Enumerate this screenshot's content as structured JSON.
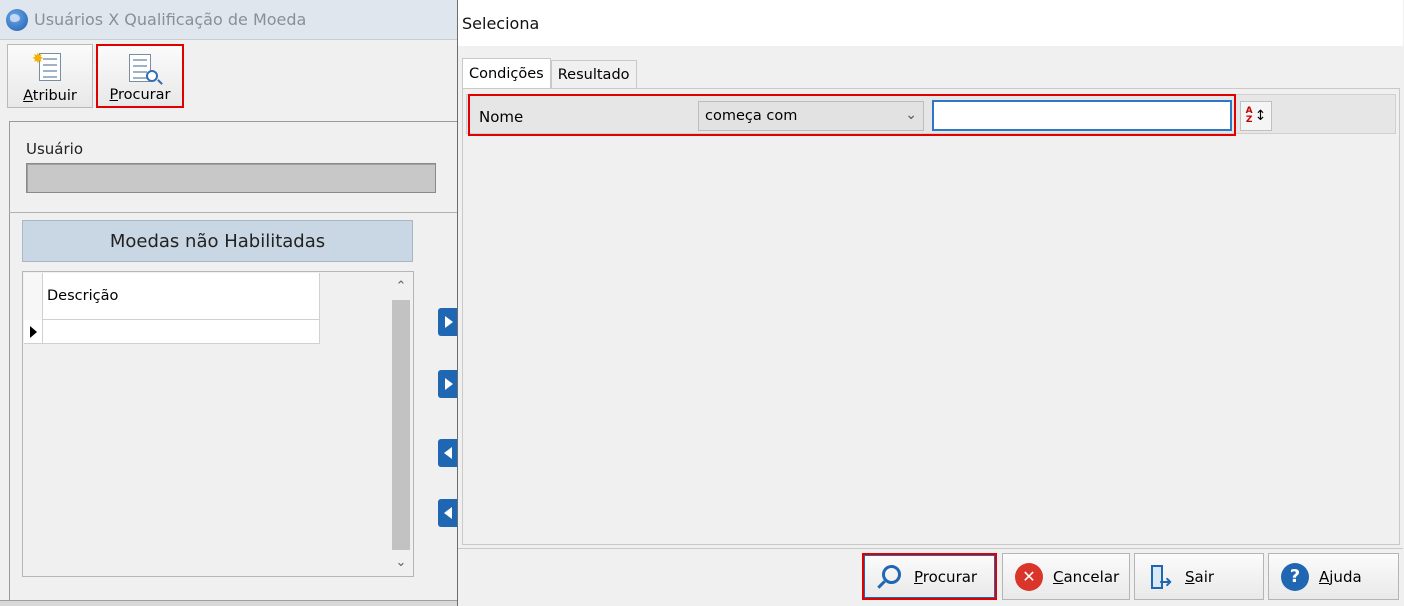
{
  "background_window": {
    "title": "Usuários X Qualificação de Moeda",
    "toolbar": {
      "atribuir_label_accel": "A",
      "atribuir_label_rest": "tribuir",
      "procurar_label_accel": "P",
      "procurar_label_rest": "rocurar"
    },
    "usuario_label": "Usuário",
    "moedas_header": "Moedas não Habilitadas",
    "grid": {
      "columns": [
        "Descrição"
      ],
      "rows": [
        ""
      ]
    }
  },
  "dialog": {
    "title": "Seleciona",
    "tabs": [
      {
        "label": "Condições",
        "active": true
      },
      {
        "label": "Resultado",
        "active": false
      }
    ],
    "condition": {
      "field_label": "Nome",
      "operator_selected": "começa com",
      "value": ""
    },
    "footer_buttons": {
      "procurar_accel": "P",
      "procurar_rest": "rocurar",
      "cancelar_accel": "C",
      "cancelar_rest": "ancelar",
      "sair_accel": "S",
      "sair_rest": "air",
      "ajuda_accel": "A",
      "ajuda_rest": "juda"
    }
  },
  "colors": {
    "highlight": "#e00000",
    "accent_blue": "#1f66b3",
    "header_blue": "#c9d6e3"
  },
  "icons": [
    "globe-icon",
    "new-doc-icon",
    "search-doc-icon",
    "sort-az-icon",
    "search-icon",
    "cancel-icon",
    "exit-icon",
    "help-icon"
  ]
}
